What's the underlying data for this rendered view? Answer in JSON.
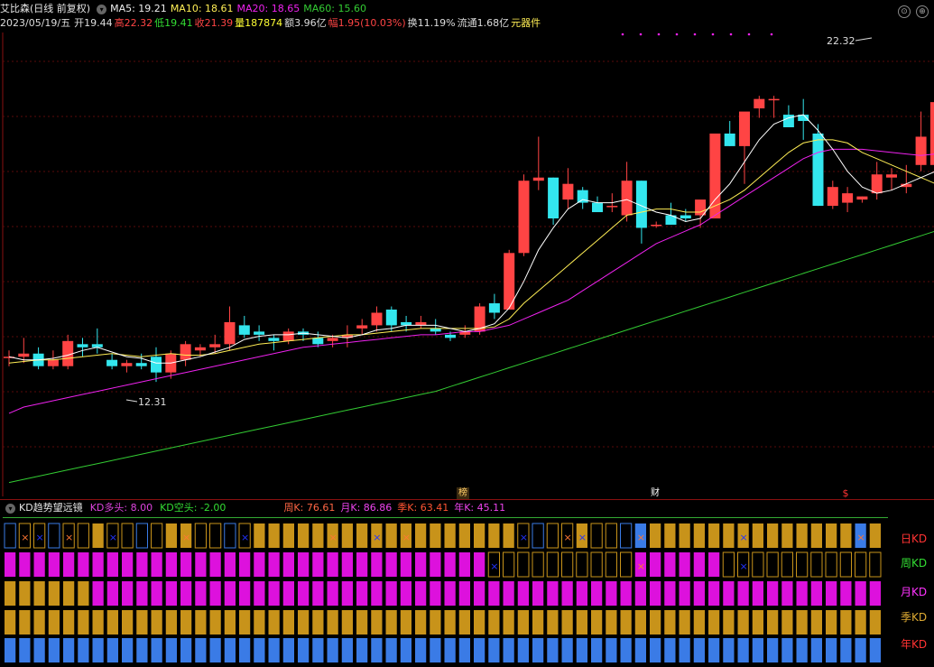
{
  "header": {
    "name": "艾比森(日线 前复权)",
    "ma5": "MA5: 19.21",
    "ma10": "MA10: 18.61",
    "ma20": "MA20: 18.65",
    "ma60": "MA60: 15.60",
    "date": "2023/05/19/五",
    "open": "开19.44",
    "high": "高22.32",
    "low": "低19.41",
    "close": "收21.39",
    "volume": "量187874",
    "amount": "额3.96亿",
    "change": "幅1.95(10.03%)",
    "turnover": "换11.19%",
    "float": "流通1.68亿",
    "sector": "元器件"
  },
  "annotations": {
    "high_label": "22.32",
    "low_label": "12.31",
    "marker_bang": "榜",
    "marker_finance": "财",
    "marker_dollar": "$"
  },
  "kd_panel": {
    "title": "KD趋势望远镜",
    "long_label": "KD多头: 8.00",
    "short_label": "KD空头: -2.00",
    "week_k": "周K: 76.61",
    "month_k": "月K: 86.86",
    "season_k": "季K: 63.41",
    "year_k": "年K: 45.11",
    "rows": [
      "日KD",
      "周KD",
      "月KD",
      "季KD",
      "年KD"
    ]
  },
  "colors": {
    "up": "#ff4444",
    "down": "#33e6ee",
    "ma5": "#ffffff",
    "ma10": "#ffee55",
    "ma20": "#ee22ee",
    "ma60": "#33cc33",
    "gold": "#c8931a",
    "magenta": "#dd11dd",
    "blue": "#3a7be6",
    "label_red": "#ff3333",
    "label_green": "#33dd33",
    "label_yellow": "#ffff33",
    "label_cyan": "#33ddff"
  },
  "chart_data": {
    "type": "candlestick",
    "price_range": [
      9.0,
      23.5
    ],
    "ohlc": [
      [
        13.3,
        13.5,
        13.0,
        13.3
      ],
      [
        13.3,
        13.9,
        13.1,
        13.4
      ],
      [
        13.4,
        13.6,
        12.9,
        13.0
      ],
      [
        13.0,
        13.5,
        12.9,
        13.2
      ],
      [
        13.0,
        14.0,
        12.9,
        13.8
      ],
      [
        13.7,
        13.9,
        13.3,
        13.6
      ],
      [
        13.7,
        14.2,
        13.4,
        13.6
      ],
      [
        13.2,
        13.4,
        12.9,
        13.0
      ],
      [
        13.0,
        13.2,
        12.8,
        13.1
      ],
      [
        13.1,
        13.4,
        12.9,
        13.0
      ],
      [
        13.3,
        13.6,
        12.5,
        12.8
      ],
      [
        12.8,
        13.5,
        12.6,
        13.4
      ],
      [
        13.2,
        13.8,
        13.0,
        13.7
      ],
      [
        13.5,
        13.7,
        13.3,
        13.6
      ],
      [
        13.6,
        14.0,
        13.4,
        13.7
      ],
      [
        13.7,
        14.9,
        13.5,
        14.4
      ],
      [
        14.3,
        14.6,
        13.9,
        14.0
      ],
      [
        14.1,
        14.3,
        13.8,
        14.0
      ],
      [
        13.9,
        14.0,
        13.5,
        13.8
      ],
      [
        13.8,
        14.2,
        13.7,
        14.1
      ],
      [
        14.1,
        14.2,
        13.8,
        14.0
      ],
      [
        13.9,
        14.1,
        13.6,
        13.7
      ],
      [
        13.8,
        14.0,
        13.6,
        13.9
      ],
      [
        13.9,
        14.3,
        13.6,
        14.0
      ],
      [
        14.2,
        14.5,
        14.0,
        14.3
      ],
      [
        14.3,
        14.9,
        14.1,
        14.7
      ],
      [
        14.8,
        14.9,
        14.1,
        14.3
      ],
      [
        14.4,
        14.6,
        14.1,
        14.3
      ],
      [
        14.3,
        14.6,
        14.2,
        14.4
      ],
      [
        14.2,
        14.5,
        14.0,
        14.1
      ],
      [
        14.0,
        14.1,
        13.8,
        13.9
      ],
      [
        14.0,
        14.3,
        13.9,
        14.1
      ],
      [
        14.1,
        15.0,
        14.0,
        14.9
      ],
      [
        15.0,
        15.3,
        14.5,
        14.7
      ],
      [
        14.8,
        16.7,
        14.8,
        16.6
      ],
      [
        16.6,
        19.1,
        16.5,
        18.9
      ],
      [
        18.9,
        20.3,
        18.6,
        19.0
      ],
      [
        19.0,
        19.0,
        17.5,
        17.7
      ],
      [
        18.3,
        19.3,
        18.0,
        18.8
      ],
      [
        18.6,
        18.7,
        18.0,
        18.2
      ],
      [
        18.2,
        18.4,
        17.9,
        17.9
      ],
      [
        18.1,
        18.5,
        17.9,
        18.1
      ],
      [
        17.8,
        19.5,
        17.6,
        18.9
      ],
      [
        18.9,
        18.9,
        16.9,
        17.4
      ],
      [
        17.5,
        17.6,
        17.4,
        17.5
      ],
      [
        17.8,
        18.2,
        17.5,
        17.5
      ],
      [
        17.8,
        18.0,
        17.6,
        17.7
      ],
      [
        17.8,
        18.2,
        17.4,
        18.3
      ],
      [
        17.7,
        20.2,
        17.7,
        20.4
      ],
      [
        20.4,
        20.8,
        20.0,
        20.0
      ],
      [
        20.0,
        21.0,
        18.8,
        21.1
      ],
      [
        21.2,
        21.6,
        20.9,
        21.5
      ],
      [
        21.5,
        21.6,
        20.9,
        21.5
      ],
      [
        21.0,
        21.3,
        20.7,
        20.6
      ],
      [
        21.0,
        21.5,
        20.2,
        20.8
      ],
      [
        20.4,
        20.7,
        18.1,
        18.1
      ],
      [
        18.1,
        18.9,
        18.0,
        18.7
      ],
      [
        18.2,
        18.7,
        17.9,
        18.5
      ],
      [
        18.3,
        18.4,
        18.2,
        18.4
      ],
      [
        18.5,
        19.5,
        18.3,
        19.1
      ],
      [
        19.0,
        19.3,
        18.6,
        19.1
      ],
      [
        18.7,
        19.4,
        18.5,
        18.8
      ],
      [
        19.4,
        21.1,
        19.2,
        20.3
      ],
      [
        19.4,
        22.3,
        19.4,
        21.4
      ]
    ],
    "ma5": [
      13.3,
      13.2,
      13.2,
      13.25,
      13.35,
      13.5,
      13.6,
      13.45,
      13.3,
      13.25,
      13.1,
      13.1,
      13.2,
      13.3,
      13.45,
      13.6,
      13.85,
      13.95,
      14.0,
      14.0,
      14.05,
      14.0,
      13.95,
      13.9,
      14.0,
      14.15,
      14.2,
      14.3,
      14.3,
      14.3,
      14.2,
      14.1,
      14.2,
      14.35,
      14.85,
      15.7,
      16.7,
      17.4,
      18.0,
      18.3,
      18.2,
      18.2,
      18.3,
      18.1,
      17.9,
      17.8,
      17.6,
      17.7,
      18.3,
      18.8,
      19.5,
      20.2,
      20.7,
      20.9,
      21.0,
      20.5,
      19.9,
      19.2,
      18.7,
      18.5,
      18.6,
      18.8,
      19.0,
      19.2,
      20.3
    ],
    "ma10": [
      13.1,
      13.15,
      13.2,
      13.2,
      13.25,
      13.3,
      13.35,
      13.4,
      13.35,
      13.3,
      13.35,
      13.4,
      13.35,
      13.35,
      13.4,
      13.5,
      13.6,
      13.7,
      13.75,
      13.8,
      13.85,
      13.9,
      13.95,
      14.0,
      14.0,
      14.05,
      14.1,
      14.15,
      14.2,
      14.2,
      14.2,
      14.2,
      14.2,
      14.25,
      14.5,
      15.0,
      15.4,
      15.8,
      16.2,
      16.6,
      17.0,
      17.4,
      17.8,
      17.9,
      18.0,
      18.0,
      17.9,
      17.9,
      18.1,
      18.3,
      18.6,
      19.0,
      19.4,
      19.8,
      20.1,
      20.2,
      20.2,
      20.1,
      19.8,
      19.6,
      19.4,
      19.2,
      19.0,
      18.8,
      18.8
    ],
    "ma20": [
      11.5,
      11.7,
      11.8,
      11.9,
      12.0,
      12.1,
      12.2,
      12.3,
      12.4,
      12.5,
      12.6,
      12.7,
      12.8,
      12.9,
      13.0,
      13.1,
      13.2,
      13.3,
      13.4,
      13.5,
      13.6,
      13.65,
      13.7,
      13.75,
      13.8,
      13.85,
      13.9,
      13.95,
      14.0,
      14.0,
      14.05,
      14.1,
      14.1,
      14.2,
      14.3,
      14.5,
      14.7,
      14.9,
      15.1,
      15.4,
      15.7,
      16.0,
      16.3,
      16.6,
      16.9,
      17.1,
      17.3,
      17.5,
      17.8,
      18.1,
      18.4,
      18.7,
      19.0,
      19.3,
      19.6,
      19.8,
      19.9,
      19.9,
      19.9,
      19.85,
      19.8,
      19.75,
      19.7,
      19.75,
      20.0
    ],
    "ma60": [
      9.3,
      9.4,
      9.5,
      9.6,
      9.7,
      9.8,
      9.9,
      10.0,
      10.1,
      10.2,
      10.3,
      10.4,
      10.5,
      10.6,
      10.7,
      10.8,
      10.9,
      11.0,
      11.1,
      11.2,
      11.3,
      11.4,
      11.5,
      11.6,
      11.7,
      11.8,
      11.9,
      12.0,
      12.1,
      12.2,
      12.35,
      12.5,
      12.65,
      12.8,
      12.95,
      13.1,
      13.25,
      13.4,
      13.55,
      13.7,
      13.85,
      14.0,
      14.15,
      14.3,
      14.45,
      14.6,
      14.75,
      14.9,
      15.05,
      15.2,
      15.35,
      15.5,
      15.65,
      15.8,
      15.95,
      16.1,
      16.25,
      16.4,
      16.55,
      16.7,
      16.85,
      17.0,
      17.15,
      17.3,
      17.5
    ]
  }
}
